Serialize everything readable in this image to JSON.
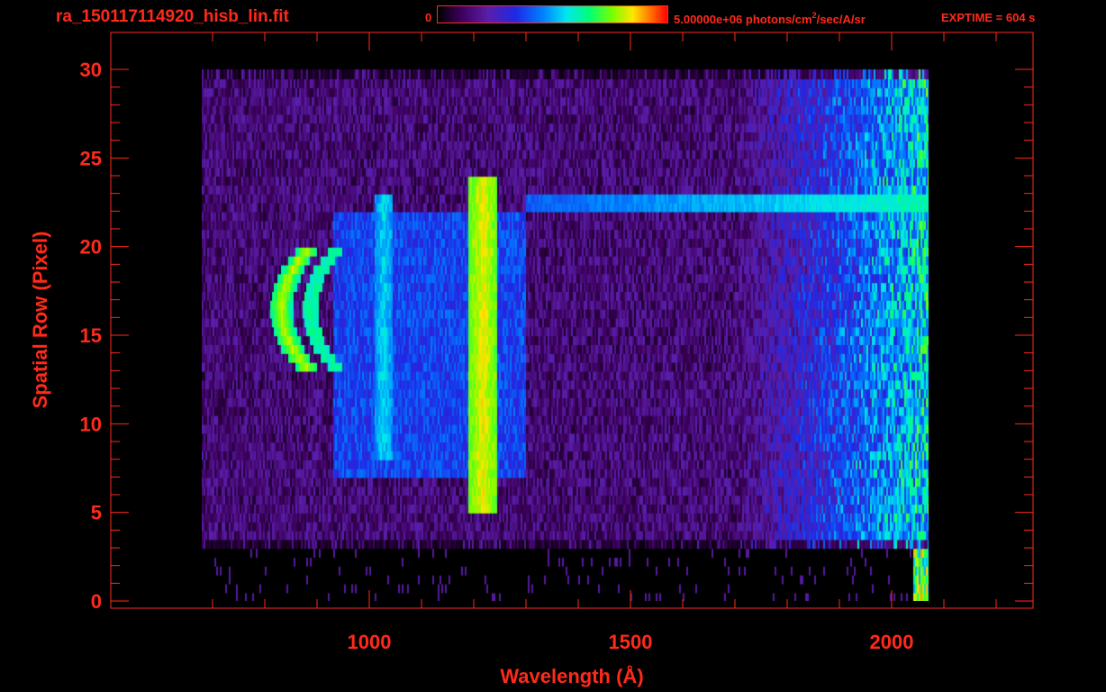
{
  "header": {
    "filename": "ra_150117114920_hisb_lin.fit",
    "colorbar_min": "0",
    "colorbar_max_prefix": "5.00000e+06 photons/cm",
    "colorbar_max_sup": "2",
    "colorbar_max_suffix": "/sec/A/sr",
    "exptime": "EXPTIME = 604 s"
  },
  "colors": {
    "axis": "#ff2a1a",
    "background": "#000000"
  },
  "chart_data": {
    "type": "heatmap",
    "title": "ra_150117114920_hisb_lin.fit",
    "xlabel": "Wavelength (Å)",
    "ylabel": "Spatial Row (Pixel)",
    "xlim": [
      600,
      2250
    ],
    "ylim": [
      0,
      30
    ],
    "x_ticks": [
      1000,
      1500,
      2000
    ],
    "y_ticks": [
      0,
      5,
      10,
      15,
      20,
      25,
      30
    ],
    "color_scale": {
      "min": 0,
      "max": 5000000,
      "units": "photons/cm^2/sec/A/sr",
      "colormap": "rainbow"
    },
    "data_extent": {
      "x": [
        680,
        2070
      ],
      "y": [
        0,
        30
      ]
    },
    "features": [
      {
        "wavelength": 830,
        "rows": [
          13,
          20
        ],
        "peak": "yellow-green"
      },
      {
        "wavelength": 1026,
        "rows": [
          8,
          23
        ],
        "peak": "cyan"
      },
      {
        "wavelength": 1216,
        "rows": [
          5,
          24
        ],
        "peak": "yellow-green"
      },
      {
        "wavelength_range": [
          1300,
          2070
        ],
        "row": 22.5,
        "peak": "cyan"
      }
    ]
  }
}
